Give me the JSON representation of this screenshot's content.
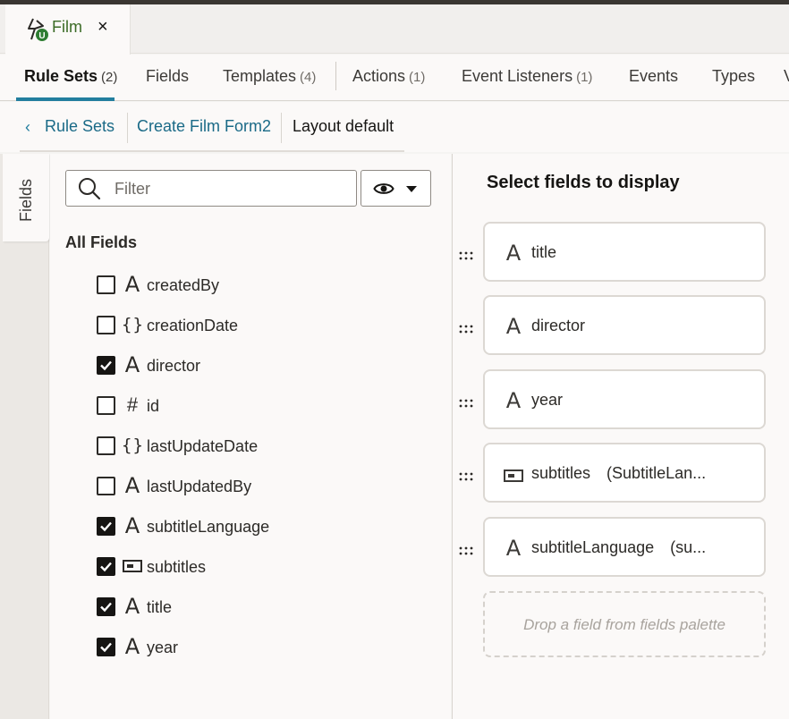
{
  "document_tab": {
    "title": "Film",
    "close": "×",
    "icon": "event-rule-icon"
  },
  "nav_tabs": [
    {
      "label": "Rule Sets",
      "count": "(2)",
      "active": true
    },
    {
      "label": "Fields",
      "count": ""
    },
    {
      "label": "Templates",
      "count": "(4)"
    },
    {
      "label": "Actions",
      "count": "(1)"
    },
    {
      "label": "Event Listeners",
      "count": "(1)"
    },
    {
      "label": "Events",
      "count": ""
    },
    {
      "label": "Types",
      "count": ""
    }
  ],
  "breadcrumb": {
    "back": "‹",
    "items": [
      "Rule Sets",
      "Create Film Form2",
      "Layout default"
    ]
  },
  "side_tab": {
    "label": "Fields"
  },
  "filter": {
    "placeholder": "Filter",
    "value": ""
  },
  "palette": {
    "heading": "All Fields",
    "fields": [
      {
        "name": "createdBy",
        "type": "text",
        "checked": false
      },
      {
        "name": "creationDate",
        "type": "object",
        "checked": false
      },
      {
        "name": "director",
        "type": "text",
        "checked": true
      },
      {
        "name": "id",
        "type": "number",
        "checked": false
      },
      {
        "name": "lastUpdateDate",
        "type": "object",
        "checked": false
      },
      {
        "name": "lastUpdatedBy",
        "type": "text",
        "checked": false
      },
      {
        "name": "subtitleLanguage",
        "type": "text",
        "checked": true
      },
      {
        "name": "subtitles",
        "type": "reference",
        "checked": true
      },
      {
        "name": "title",
        "type": "text",
        "checked": true
      },
      {
        "name": "year",
        "type": "text",
        "checked": true
      }
    ]
  },
  "layout": {
    "title": "Select fields to display",
    "slots": [
      {
        "name": "title",
        "type": "text",
        "detail": ""
      },
      {
        "name": "director",
        "type": "text",
        "detail": ""
      },
      {
        "name": "year",
        "type": "text",
        "detail": ""
      },
      {
        "name": "subtitles",
        "type": "reference",
        "detail": "(SubtitleLan..."
      },
      {
        "name": "subtitleLanguage",
        "type": "text",
        "detail": "(su..."
      }
    ],
    "drop_hint": "Drop a field from fields palette"
  },
  "colors": {
    "accent": "#227e9e",
    "link": "#1a6a87",
    "tab_title": "#3b6b26",
    "badge": "#2e7d32"
  }
}
